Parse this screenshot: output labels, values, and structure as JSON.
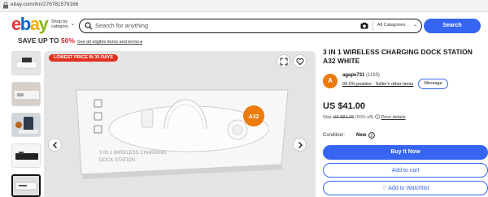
{
  "browser": {
    "url": "ebay.com/itm/276781579166"
  },
  "header": {
    "logo": [
      "e",
      "b",
      "a",
      "y"
    ],
    "shop_by_category": "Shop by category",
    "search_placeholder": "Search for anything",
    "category_select": "All Categories",
    "search_button": "Search"
  },
  "promo": {
    "save_prefix": "SAVE UP TO ",
    "save_percent": "50%",
    "link": "See all eligible items and terms ▸"
  },
  "gallery": {
    "badge": "LOWEST PRICE IN 30 DAYS",
    "thumb_count": 5,
    "selected_thumb": 5,
    "product_text": [
      "3 IN 1 WIRELESS CHARGING",
      "DOCK STATION"
    ],
    "product_badge": "A32"
  },
  "item": {
    "title": "3 IN 1 WIRELESS CHARGING DOCK STATION A32 WHITE"
  },
  "seller": {
    "avatar_letter": "A",
    "name": "agape731",
    "feedback_count": "(1169)",
    "positive": "99.5% positive",
    "separator": " · ",
    "other_items": "Seller's other items",
    "message_button": "Message"
  },
  "pricing": {
    "price": "US $41.00",
    "was_label": "Was ",
    "was_price": "US $81.99",
    "discount": " (50% off) ",
    "price_details": "Price details"
  },
  "condition": {
    "label": "Condition:",
    "value": "New"
  },
  "actions": {
    "buy_now": "Buy It Now",
    "add_to_cart": "Add to cart",
    "watchlist": "♡ Add to Watchlist"
  },
  "colors": {
    "accent": "#3665f3",
    "badge": "#e0301e",
    "avatar": "#ec7a0c"
  }
}
